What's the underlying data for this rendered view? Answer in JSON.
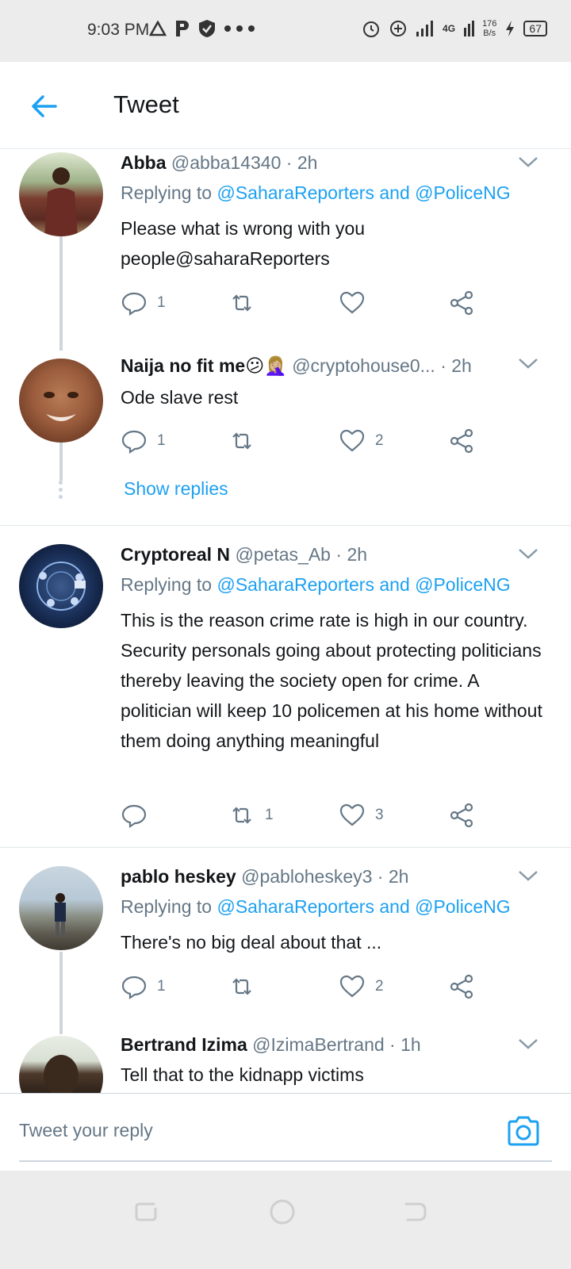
{
  "status_bar": {
    "time": "9:03 PM",
    "net_speed_top": "176",
    "net_speed_bottom": "B/s",
    "network": "4G",
    "battery": "67"
  },
  "header": {
    "title": "Tweet"
  },
  "tweets": [
    {
      "name": "Abba",
      "handle": "@abba14340",
      "time": "2h",
      "replying_prefix": "Replying to ",
      "replying_to": "@SaharaReporters and @PoliceNG",
      "text": "Please what is wrong with you people@saharaReporters",
      "replies": "1",
      "retweets": "",
      "likes": ""
    },
    {
      "name": "Naija no fit me😕🤦🏼‍♀️",
      "handle": "@cryptohouse0...",
      "time": "2h",
      "text": "Ode slave rest",
      "replies": "1",
      "retweets": "",
      "likes": "2",
      "show_replies": "Show replies"
    },
    {
      "name": "Cryptoreal N",
      "handle": "@petas_Ab",
      "time": "2h",
      "replying_prefix": "Replying to ",
      "replying_to": "@SaharaReporters and @PoliceNG",
      "text": "This is the reason crime rate is high in our country. Security personals going about protecting politicians thereby leaving the society open for crime. A politician will keep 10 policemen at his home without them doing anything meaningful",
      "replies": "",
      "retweets": "1",
      "likes": "3"
    },
    {
      "name": "pablo heskey",
      "handle": "@pabloheskey3",
      "time": "2h",
      "replying_prefix": "Replying to ",
      "replying_to": "@SaharaReporters and @PoliceNG",
      "text": "There's no big deal about that ...",
      "replies": "1",
      "retweets": "",
      "likes": "2"
    },
    {
      "name": "Bertrand Izima",
      "handle": "@IzimaBertrand",
      "time": "1h",
      "text": "Tell that to the kidnapp victims"
    }
  ],
  "separator": " · ",
  "reply_bar": {
    "placeholder": "Tweet your reply"
  },
  "icons": {
    "back": "arrow-left-icon",
    "reply": "comment-icon",
    "retweet": "retweet-icon",
    "like": "heart-icon",
    "share": "share-icon",
    "camera": "camera-icon"
  },
  "colors": {
    "accent": "#1da1f2",
    "muted": "#657786",
    "text": "#14171a"
  }
}
